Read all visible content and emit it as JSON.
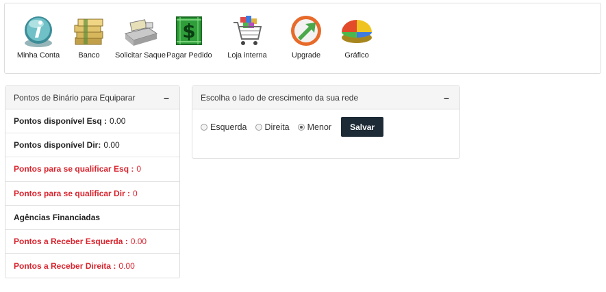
{
  "toolbar": {
    "items": [
      {
        "label": "Minha Conta",
        "icon": "info-icon"
      },
      {
        "label": "Banco",
        "icon": "money-stack-icon"
      },
      {
        "label": "Solicitar Saque",
        "icon": "cash-register-icon"
      },
      {
        "label": "Pagar Pedido",
        "icon": "dollar-sign-icon"
      },
      {
        "label": "Loja interna",
        "icon": "shopping-cart-icon"
      },
      {
        "label": "Upgrade",
        "icon": "upgrade-arrow-icon"
      },
      {
        "label": "Gráfico",
        "icon": "pie-chart-icon"
      }
    ]
  },
  "points_panel": {
    "title": "Pontos de Binário para Equiparar",
    "collapse": "–",
    "rows": [
      {
        "label": "Pontos disponível Esq :",
        "value": "0.00",
        "color": "#222222"
      },
      {
        "label": "Pontos disponível Dir:",
        "value": "0.00",
        "color": "#222222"
      },
      {
        "label": "Pontos para se qualificar Esq :",
        "value": "0",
        "color": "#d9232d"
      },
      {
        "label": "Pontos para se qualificar Dir :",
        "value": "0",
        "color": "#d9232d"
      },
      {
        "label": "Agências Financiadas",
        "value": "",
        "color": "#222222"
      },
      {
        "label": "Pontos a Receber Esquerda :",
        "value": "0.00",
        "color": "#d9232d"
      },
      {
        "label": "Pontos a Receber Direita :",
        "value": "0.00",
        "color": "#d9232d"
      }
    ]
  },
  "side_panel": {
    "title": "Escolha o lado de crescimento da sua rede",
    "collapse": "–",
    "options": [
      {
        "label": "Esquerda",
        "selected": false
      },
      {
        "label": "Direita",
        "selected": false
      },
      {
        "label": "Menor",
        "selected": true
      }
    ],
    "save_label": "Salvar"
  },
  "colors": {
    "accent_dark": "#1d2b36",
    "alert_red": "#d9232d"
  }
}
